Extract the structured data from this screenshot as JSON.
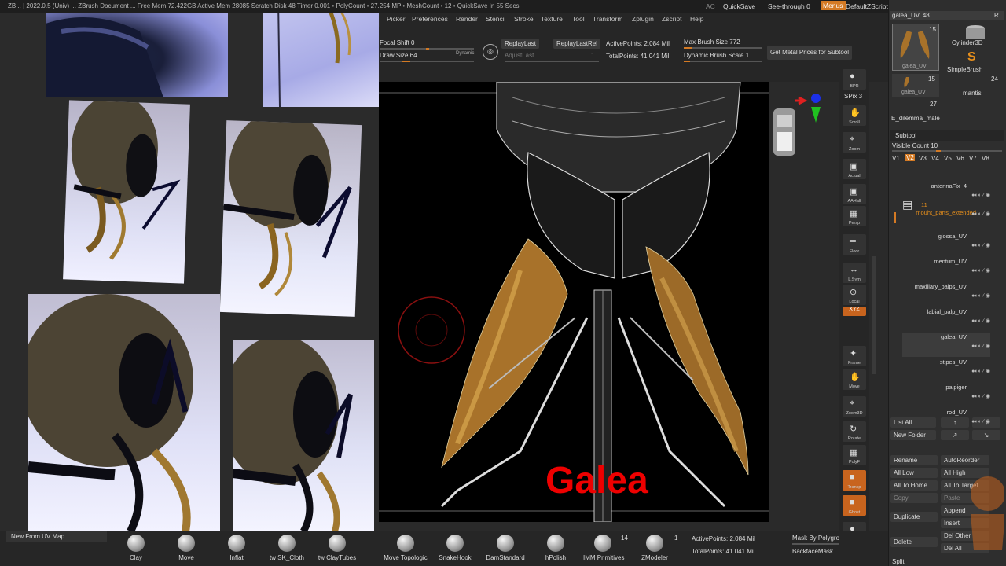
{
  "titlebar": {
    "text": "ZB... | 2022.0.5 (Univ) ... ZBrush Document ... Free Mem 72.422GB  Active Mem 28085  Scratch Disk 48  Timer 0.001  • PolyCount • 27.254 MP  • MeshCount • 12  • QuickSave In 55 Secs",
    "ac": "AC",
    "quicksave": "QuickSave",
    "seethrough": "See-through",
    "seethrough_value": "0",
    "menus": "Menus",
    "script": "DefaultZScript"
  },
  "menus": [
    "Picker",
    "Preferences",
    "Render",
    "Stencil",
    "Stroke",
    "Texture",
    "Tool",
    "Transform",
    "Zplugin",
    "Zscript",
    "Help"
  ],
  "shelf": {
    "focal_shift_label": "Focal Shift",
    "focal_shift_value": "0",
    "draw_size_label": "Draw Size",
    "draw_size_value": "64",
    "dynamic": "Dynamic",
    "replay_last": "ReplayLast",
    "replay_last_rel": "ReplayLastRel",
    "adjust_last": "AdjustLast",
    "adjust_last_value": "1",
    "active_points": "ActivePoints: 2.084 Mil",
    "total_points": "TotalPoints: 41.041 Mil",
    "max_brush_label": "Max Brush Size",
    "max_brush_value": "772",
    "dyn_brush_label": "Dynamic Brush Scale",
    "dyn_brush_value": "1",
    "metal_prices": "Get Metal Prices for Subtool"
  },
  "canvas": {
    "label": "Galea"
  },
  "right_toolbar": [
    {
      "icon": "●",
      "label": "BPR"
    },
    {
      "icon": "✋",
      "label": "Scroll"
    },
    {
      "icon": "⌖",
      "label": "Zoom"
    },
    {
      "icon": "▣",
      "label": "Actual"
    },
    {
      "icon": "▣",
      "label": "AAHalf"
    },
    {
      "icon": "▦",
      "label": "Persp"
    },
    {
      "icon": "═",
      "label": "Floor"
    },
    {
      "icon": "↔",
      "label": "L.Sym"
    },
    {
      "icon": "⊙",
      "label": "Local"
    },
    {
      "icon": "✦",
      "label": "Frame"
    },
    {
      "icon": "✋",
      "label": "Move"
    },
    {
      "icon": "⌖",
      "label": "Zoom3D"
    },
    {
      "icon": "↻",
      "label": "Rotate"
    },
    {
      "icon": "▦",
      "label": "PolyF"
    },
    {
      "icon": "■",
      "label": "Transp"
    },
    {
      "icon": "■",
      "label": "Ghost"
    },
    {
      "icon": "●",
      "label": "Solo"
    },
    {
      "icon": "□",
      "label": "Xpose"
    }
  ],
  "spix": "SPix 3",
  "xyz": "XYZ",
  "tool_panel": {
    "current_tool": "galea_UV. 48",
    "r_label": "R",
    "thumb1_count": "15",
    "thumb1_name": "galea_UV",
    "cylinder": "Cylinder3D",
    "simplebrush": "SimpleBrush",
    "thumb2_count": "15",
    "thumb2_name": "galea_UV",
    "mantis_count": "24",
    "mantis": "mantis",
    "e_count": "27",
    "e_name": "E_dilemma_male"
  },
  "subtool": {
    "title": "Subtool",
    "visible_count_label": "Visible Count",
    "visible_count": "10",
    "versions": [
      "V1",
      "V2",
      "V3",
      "V4",
      "V5",
      "V6",
      "V7",
      "V8"
    ],
    "items": [
      {
        "name": "antennaFix_4"
      },
      {
        "name": "mouht_parts_extended",
        "count": "11"
      },
      {
        "name": "glossa_UV"
      },
      {
        "name": "mentum_UV"
      },
      {
        "name": "maxillary_palps_UV"
      },
      {
        "name": "labial_palp_UV"
      },
      {
        "name": "galea_UV"
      },
      {
        "name": "stipes_UV"
      },
      {
        "name": "palpiger"
      },
      {
        "name": "rod_UV"
      }
    ],
    "list_all": "List All",
    "new_folder": "New Folder",
    "rename": "Rename",
    "autoreorder": "AutoReorder",
    "all_low": "All Low",
    "all_high": "All High",
    "all_to_home": "All To Home",
    "all_to_target": "All To Target",
    "copy": "Copy",
    "paste": "Paste",
    "duplicate": "Duplicate",
    "append": "Append",
    "insert": "Insert",
    "delete": "Delete",
    "del_other": "Del Other",
    "del_all": "Del All",
    "split": "Split"
  },
  "bottom": {
    "new_from_uv": "New From UV Map",
    "brushes": [
      "Clay",
      "Move",
      "Inflat",
      "tw SK_Cloth",
      "tw ClayTubes",
      "Move Topologic",
      "SnakeHook",
      "DamStandard",
      "hPolish",
      "IMM Primitives",
      "ZModeler"
    ],
    "imm_count": "14",
    "zmodeler_count": "1",
    "active_points": "ActivePoints: 2.084 Mil",
    "total_points": "TotalPoints: 41.041 Mil",
    "mask_by_polygroups": "Mask By Polygro",
    "backface_mask": "BackfaceMask"
  },
  "colors": {
    "accent": "#d47a24",
    "ui_dark": "#262626",
    "canvas": "#000000",
    "label_red": "#e00000"
  }
}
